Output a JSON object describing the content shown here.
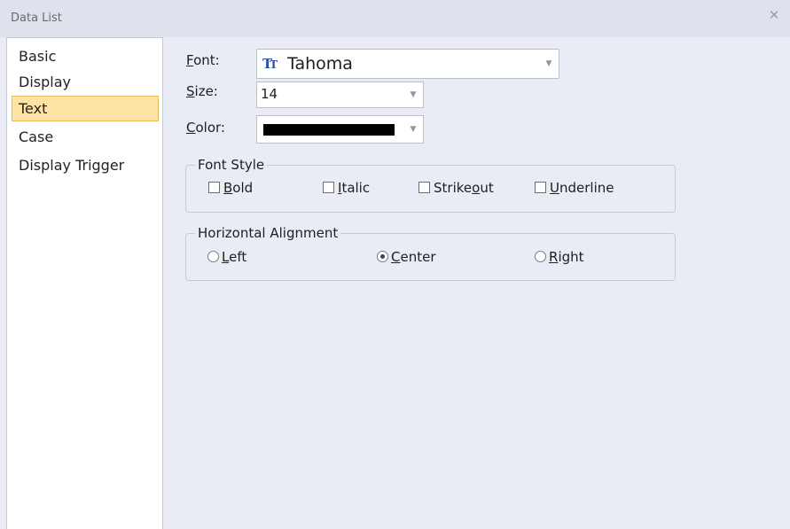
{
  "window": {
    "title": "Data List",
    "close_icon": "close-icon"
  },
  "sidebar": {
    "items": [
      {
        "label": "Basic",
        "selected": false
      },
      {
        "label": "Display",
        "selected": false
      },
      {
        "label": "Text",
        "selected": true
      },
      {
        "label": "Case",
        "selected": false
      },
      {
        "label": "Display Trigger",
        "selected": false
      }
    ]
  },
  "text_settings": {
    "font": {
      "label_mnemonic": "F",
      "label_rest": "ont:",
      "value": "Tahoma",
      "icon": "truetype-font-icon"
    },
    "size": {
      "label_mnemonic": "S",
      "label_rest": "ize:",
      "value": "14"
    },
    "color": {
      "label_mnemonic": "C",
      "label_rest": "olor:",
      "value": "#000000"
    }
  },
  "font_style": {
    "legend": "Font Style",
    "bold": {
      "mnemonic": "B",
      "rest": "old",
      "checked": false
    },
    "italic": {
      "mnemonic": "I",
      "rest": "talic",
      "checked": false
    },
    "strikeout": {
      "before": "Strike",
      "mnemonic": "o",
      "after": "ut",
      "checked": false
    },
    "underline": {
      "mnemonic": "U",
      "rest": "nderline",
      "checked": false
    }
  },
  "alignment": {
    "legend": "Horizontal Alignment",
    "left": {
      "mnemonic": "L",
      "rest": "eft"
    },
    "center": {
      "mnemonic": "C",
      "rest": "enter"
    },
    "right": {
      "mnemonic": "R",
      "rest": "ight"
    },
    "selected": "center"
  },
  "colors": {
    "selected_bg": "#fde4a4",
    "selected_border": "#e9bb55",
    "panel_bg": "#e9ecf5"
  }
}
